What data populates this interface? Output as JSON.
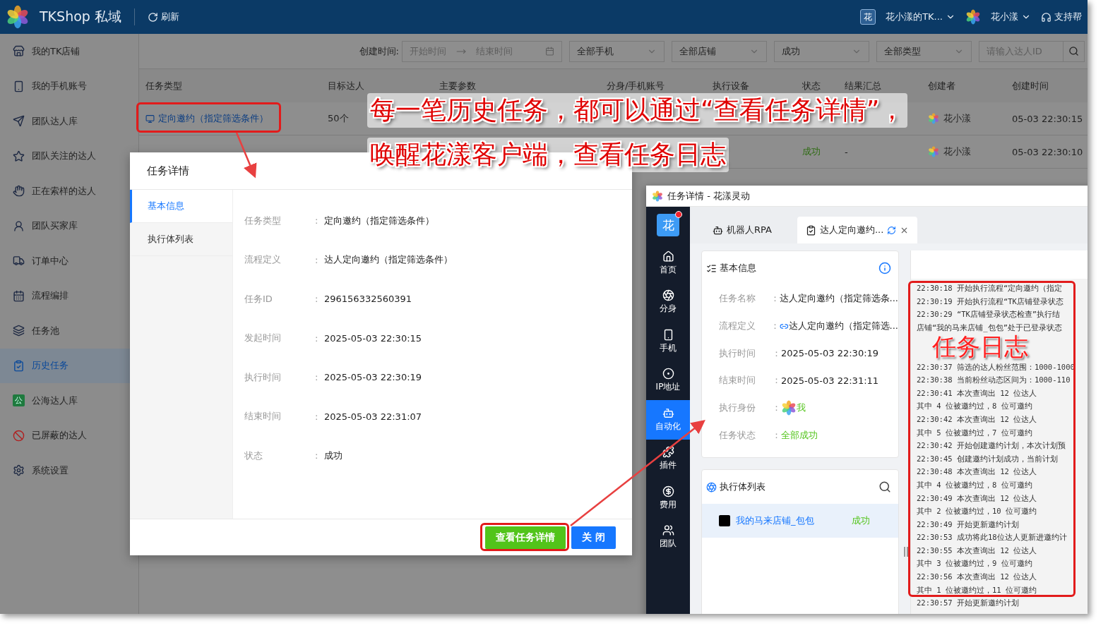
{
  "app": {
    "brand": "TKShop 私域",
    "refresh": "刷新",
    "team_badge": "花",
    "team": "花小漾的TK...",
    "user": "花小漾",
    "help": "支持帮"
  },
  "sidebar": {
    "items": [
      {
        "label": "我的TK店铺",
        "selected": false
      },
      {
        "label": "我的手机账号",
        "selected": false
      },
      {
        "label": "团队达人库",
        "selected": false
      },
      {
        "label": "团队关注的达人",
        "selected": false
      },
      {
        "label": "正在索样的达人",
        "selected": false
      },
      {
        "label": "团队买家库",
        "selected": false
      },
      {
        "label": "订单中心",
        "selected": false
      },
      {
        "label": "流程编排",
        "selected": false
      },
      {
        "label": "任务池",
        "selected": false
      },
      {
        "label": "历史任务",
        "selected": true
      },
      {
        "label": "公海达人库",
        "selected": false,
        "badge": "公"
      },
      {
        "label": "已屏蔽的达人",
        "selected": false
      },
      {
        "label": "系统设置",
        "selected": false
      }
    ]
  },
  "filters": {
    "label": "创建时间:",
    "start_placeholder": "开始时间",
    "end_placeholder": "结束时间",
    "selects": [
      "全部手机",
      "全部店铺",
      "成功",
      "全部类型"
    ],
    "search_placeholder": "请输入达人ID"
  },
  "table": {
    "columns": [
      "任务类型",
      "目标达人",
      "主要参数",
      "分身/手机账号",
      "执行设备",
      "状态",
      "结果汇总",
      "创建者",
      "创建时间"
    ],
    "rows": [
      {
        "task_type": "定向邀约（指定筛选条件）",
        "target": "50个",
        "creator": "花小漾",
        "created": "05-03 22:30:15"
      },
      {
        "status": "成功",
        "result": "-",
        "creator": "花小漾",
        "created": "05-03 22:30:10"
      }
    ]
  },
  "modal": {
    "title": "任务详情",
    "tabs": [
      {
        "label": "基本信息",
        "selected": true
      },
      {
        "label": "执行体列表",
        "selected": false
      }
    ],
    "fields": [
      {
        "label": "任务类型",
        "colon": ":",
        "value": "定向邀约（指定筛选条件）"
      },
      {
        "label": "流程定义",
        "colon": ":",
        "value": "达人定向邀约（指定筛选条件）"
      },
      {
        "label": "任务ID",
        "colon": ":",
        "value": "296156332560391"
      },
      {
        "label": "发起时间",
        "colon": ":",
        "value": "2025-05-03 22:30:15"
      },
      {
        "label": "执行时间",
        "colon": ":",
        "value": "2025-05-03 22:30:19"
      },
      {
        "label": "结束时间",
        "colon": ":",
        "value": "2025-05-03 22:31:07"
      },
      {
        "label": "状态",
        "colon": ":",
        "value": "成功"
      }
    ],
    "buttons": [
      {
        "label": "查看任务详情",
        "kind": "success"
      },
      {
        "label": "关 闭",
        "kind": "primary"
      }
    ]
  },
  "client": {
    "title": "任务详情 - 花漾灵动",
    "logo": "花",
    "nav": [
      {
        "label": "首页",
        "selected": false
      },
      {
        "label": "分身",
        "selected": false
      },
      {
        "label": "手机",
        "selected": false
      },
      {
        "label": "IP地址",
        "selected": false
      },
      {
        "label": "自动化",
        "selected": true
      },
      {
        "label": "插件",
        "selected": false
      },
      {
        "label": "费用",
        "selected": false
      },
      {
        "label": "团队",
        "selected": false
      }
    ],
    "tabs": [
      {
        "label": "机器人RPA",
        "selected": false
      },
      {
        "label": "达人定向邀约...",
        "selected": true
      }
    ],
    "info_title": "基本信息",
    "info": [
      {
        "kind": "text",
        "label": "任务名称",
        "colon": "：",
        "value": "达人定向邀约（指定筛选条..."
      },
      {
        "kind": "flow",
        "label": "流程定义",
        "colon": "：",
        "value": "达人定向邀约（指定筛选..."
      },
      {
        "kind": "text",
        "label": "执行时间",
        "colon": "：",
        "value": "2025-05-03 22:30:19"
      },
      {
        "kind": "text",
        "label": "结束时间",
        "colon": "：",
        "value": "2025-05-03 22:31:11"
      },
      {
        "kind": "identity",
        "label": "执行身份",
        "colon": "：",
        "value": "我"
      },
      {
        "kind": "status",
        "label": "任务状态",
        "colon": "：",
        "value": "全部成功"
      }
    ],
    "executors_title": "执行体列表",
    "executors": [
      {
        "name": "我的马来店铺_包包",
        "status": "成功"
      }
    ],
    "log": [
      "22:30:18 开始执行流程“定向邀约（指定",
      "22:30:19 开始执行流程“TK店铺登录状态",
      "22:30:29 “TK店铺登录状态检查”执行结",
      "店铺“我的马来店铺_包包”处于已登录状态",
      "22:30:37 筛选的达人粉丝范围：1000-1000",
      "22:30:38 当前粉丝动态区间为：1000-110",
      "22:30:41 本次查询出 12 位达人",
      "其中 4 位被邀约过，8 位可邀约",
      "22:30:42 本次查询出 12 位达人",
      "其中 5 位被邀约过，7 位可邀约",
      "22:30:42 开始创建邀约计划，本次计划预",
      "22:30:45 创建邀约计划成功，当前计划",
      "22:30:48 本次查询出 12 位达人",
      "其中 4 位被邀约过，8 位可邀约",
      "22:30:49 本次查询出 12 位达人",
      "其中 2 位被邀约过，10 位可邀约",
      "22:30:49 开始更新邀约计划",
      "22:30:53 成功将此18位达人更新进邀约计",
      "22:30:55 本次查询出 12 位达人",
      "其中 3 位被邀约过，9 位可邀约",
      "22:30:56 本次查询出 12 位达人",
      "其中 1 位被邀约过，11 位可邀约",
      "22:30:57 开始更新邀约计划"
    ]
  },
  "annotations": {
    "lines": [
      "每一笔历史任务，都可以通过“查看任务详情”，",
      "唤醒花漾客户端，查看任务日志"
    ],
    "log_note": "任务日志"
  }
}
